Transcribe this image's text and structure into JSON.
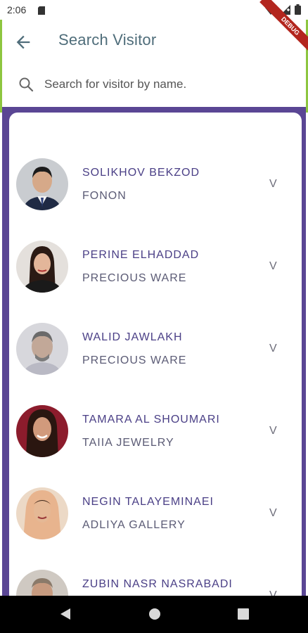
{
  "status_bar": {
    "time": "2:06"
  },
  "debug_ribbon": "DEBUG",
  "header": {
    "title": "Search Visitor"
  },
  "search": {
    "placeholder": "Search for visitor by name."
  },
  "visitors": [
    {
      "name": "SOLIKHOV BEKZOD",
      "company": "FONON",
      "action": "V"
    },
    {
      "name": "PERINE ELHADDAD",
      "company": "PRECIOUS WARE",
      "action": "V"
    },
    {
      "name": "WALID JAWLAKH",
      "company": "PRECIOUS WARE",
      "action": "V"
    },
    {
      "name": "TAMARA AL SHOUMARI",
      "company": "TAIIA JEWELRY",
      "action": "V"
    },
    {
      "name": "NEGIN TALAYEMINAEI",
      "company": "ADLIYA GALLERY",
      "action": "V"
    },
    {
      "name": "ZUBIN NASR NASRABADI",
      "company": "",
      "action": "V"
    }
  ],
  "colors": {
    "accent": "#5a4694",
    "title": "#4f6d7a",
    "edge": "#8dc63f"
  }
}
